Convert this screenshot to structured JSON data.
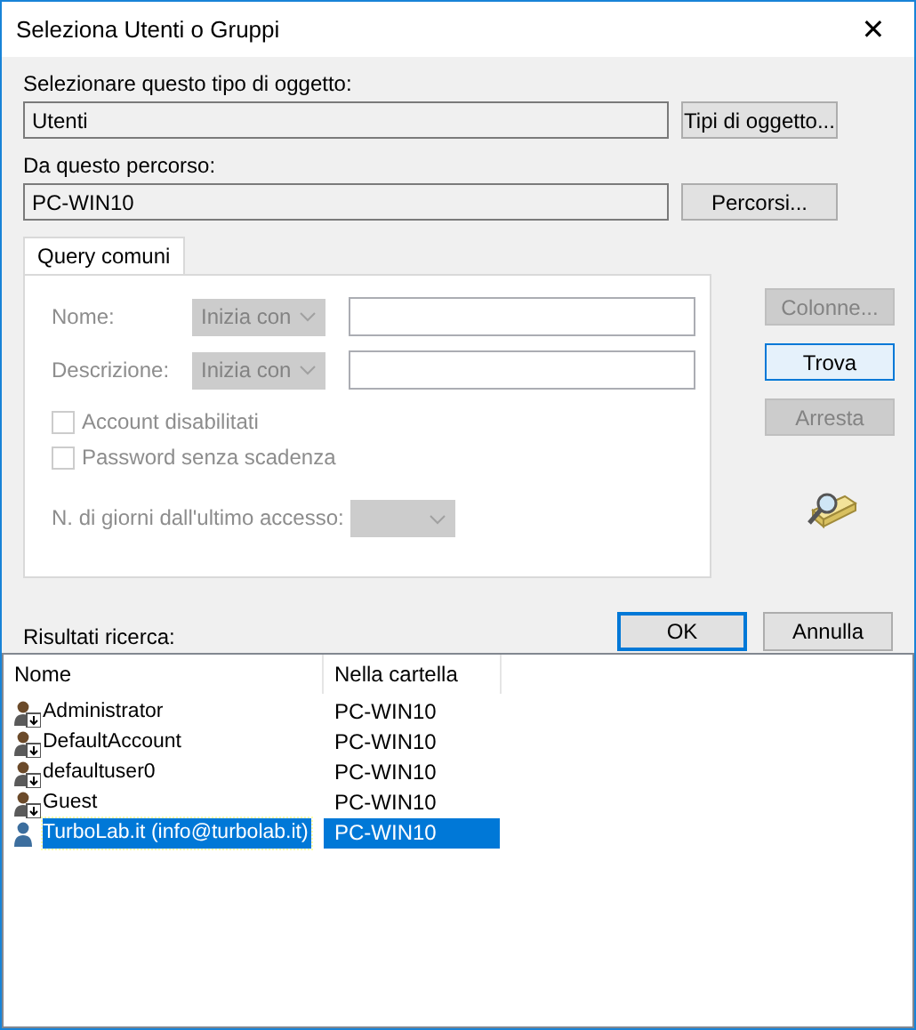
{
  "window": {
    "title": "Seleziona Utenti o Gruppi",
    "close": "✕"
  },
  "object_type": {
    "label": "Selezionare questo tipo di oggetto:",
    "value": "Utenti",
    "button": "Tipi di oggetto..."
  },
  "location": {
    "label": "Da questo percorso:",
    "value": "PC-WIN10",
    "button": "Percorsi..."
  },
  "tabs": [
    {
      "label": "Query comuni",
      "selected": true
    }
  ],
  "query": {
    "fields": [
      {
        "label": "Nome:",
        "operator": "Inizia con",
        "disabled": true
      },
      {
        "label": "Descrizione:",
        "operator": "Inizia con",
        "disabled": true
      }
    ],
    "checkboxes": [
      {
        "label": "Account disabilitati",
        "checked": false,
        "disabled": true
      },
      {
        "label": "Password senza scadenza",
        "checked": false,
        "disabled": true
      }
    ],
    "days": {
      "label": "N. di giorni dall'ultimo accesso:",
      "disabled": true
    }
  },
  "side_buttons": [
    {
      "label": "Colonne...",
      "disabled": true,
      "hovered": false
    },
    {
      "label": "Trova",
      "disabled": false,
      "hovered": true
    },
    {
      "label": "Arresta",
      "disabled": true,
      "hovered": false
    }
  ],
  "dialog_buttons": [
    {
      "label": "OK",
      "default": true
    },
    {
      "label": "Annulla",
      "default": false
    }
  ],
  "results": {
    "label": "Risultati ricerca:",
    "columns": [
      "Nome",
      "Nella cartella"
    ],
    "rows": [
      {
        "kind": "overlay",
        "name": "Administrator",
        "folder": "PC-WIN10",
        "selected": false
      },
      {
        "kind": "overlay",
        "name": "DefaultAccount",
        "folder": "PC-WIN10",
        "selected": false
      },
      {
        "kind": "overlay",
        "name": "defaultuser0",
        "folder": "PC-WIN10",
        "selected": false
      },
      {
        "kind": "overlay",
        "name": "Guest",
        "folder": "PC-WIN10",
        "selected": false
      },
      {
        "kind": "plain",
        "name": "TurboLab.it (info@turbolab.it)",
        "folder": "PC-WIN10",
        "selected": true
      }
    ]
  }
}
